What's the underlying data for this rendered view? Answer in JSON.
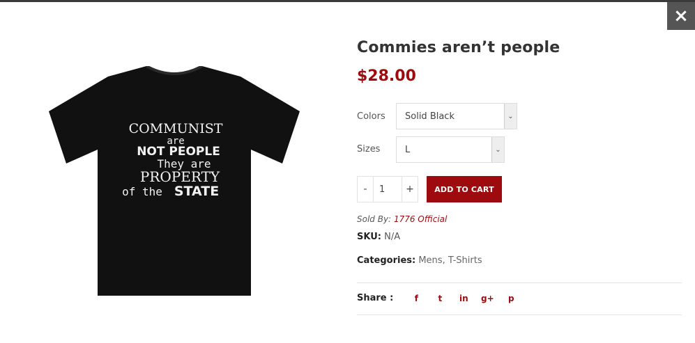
{
  "modal": {
    "close_glyph": "×"
  },
  "product": {
    "title": "Commies aren’t people",
    "price": "$28.00",
    "image": {
      "shirt_color": "#111111",
      "print_lines": [
        "COMMUNIST",
        "are",
        "NOT PEOPLE",
        "They are",
        "PROPERTY",
        "of the",
        "STATE"
      ]
    }
  },
  "options": {
    "colors": {
      "label": "Colors",
      "selected": "Solid Black"
    },
    "sizes": {
      "label": "Sizes",
      "selected": "L"
    }
  },
  "quantity": {
    "minus": "-",
    "value": "1",
    "plus": "+"
  },
  "cart": {
    "add_label": "ADD TO CART"
  },
  "meta": {
    "sold_by_label": "Sold By:",
    "sold_by_value": "1776 Official",
    "sku_label": "SKU:",
    "sku_value": "N/A",
    "categories_label": "Categories:",
    "categories": [
      "Mens",
      "T-Shirts"
    ]
  },
  "share": {
    "label": "Share :",
    "icons": [
      {
        "name": "facebook-icon",
        "glyph": "f"
      },
      {
        "name": "twitter-icon",
        "glyph": "t"
      },
      {
        "name": "linkedin-icon",
        "glyph": "in"
      },
      {
        "name": "google-plus-icon",
        "glyph": "g+"
      },
      {
        "name": "pinterest-icon",
        "glyph": "p"
      }
    ]
  },
  "colors": {
    "accent": "#9e0b0f",
    "close_bg": "#555555"
  }
}
